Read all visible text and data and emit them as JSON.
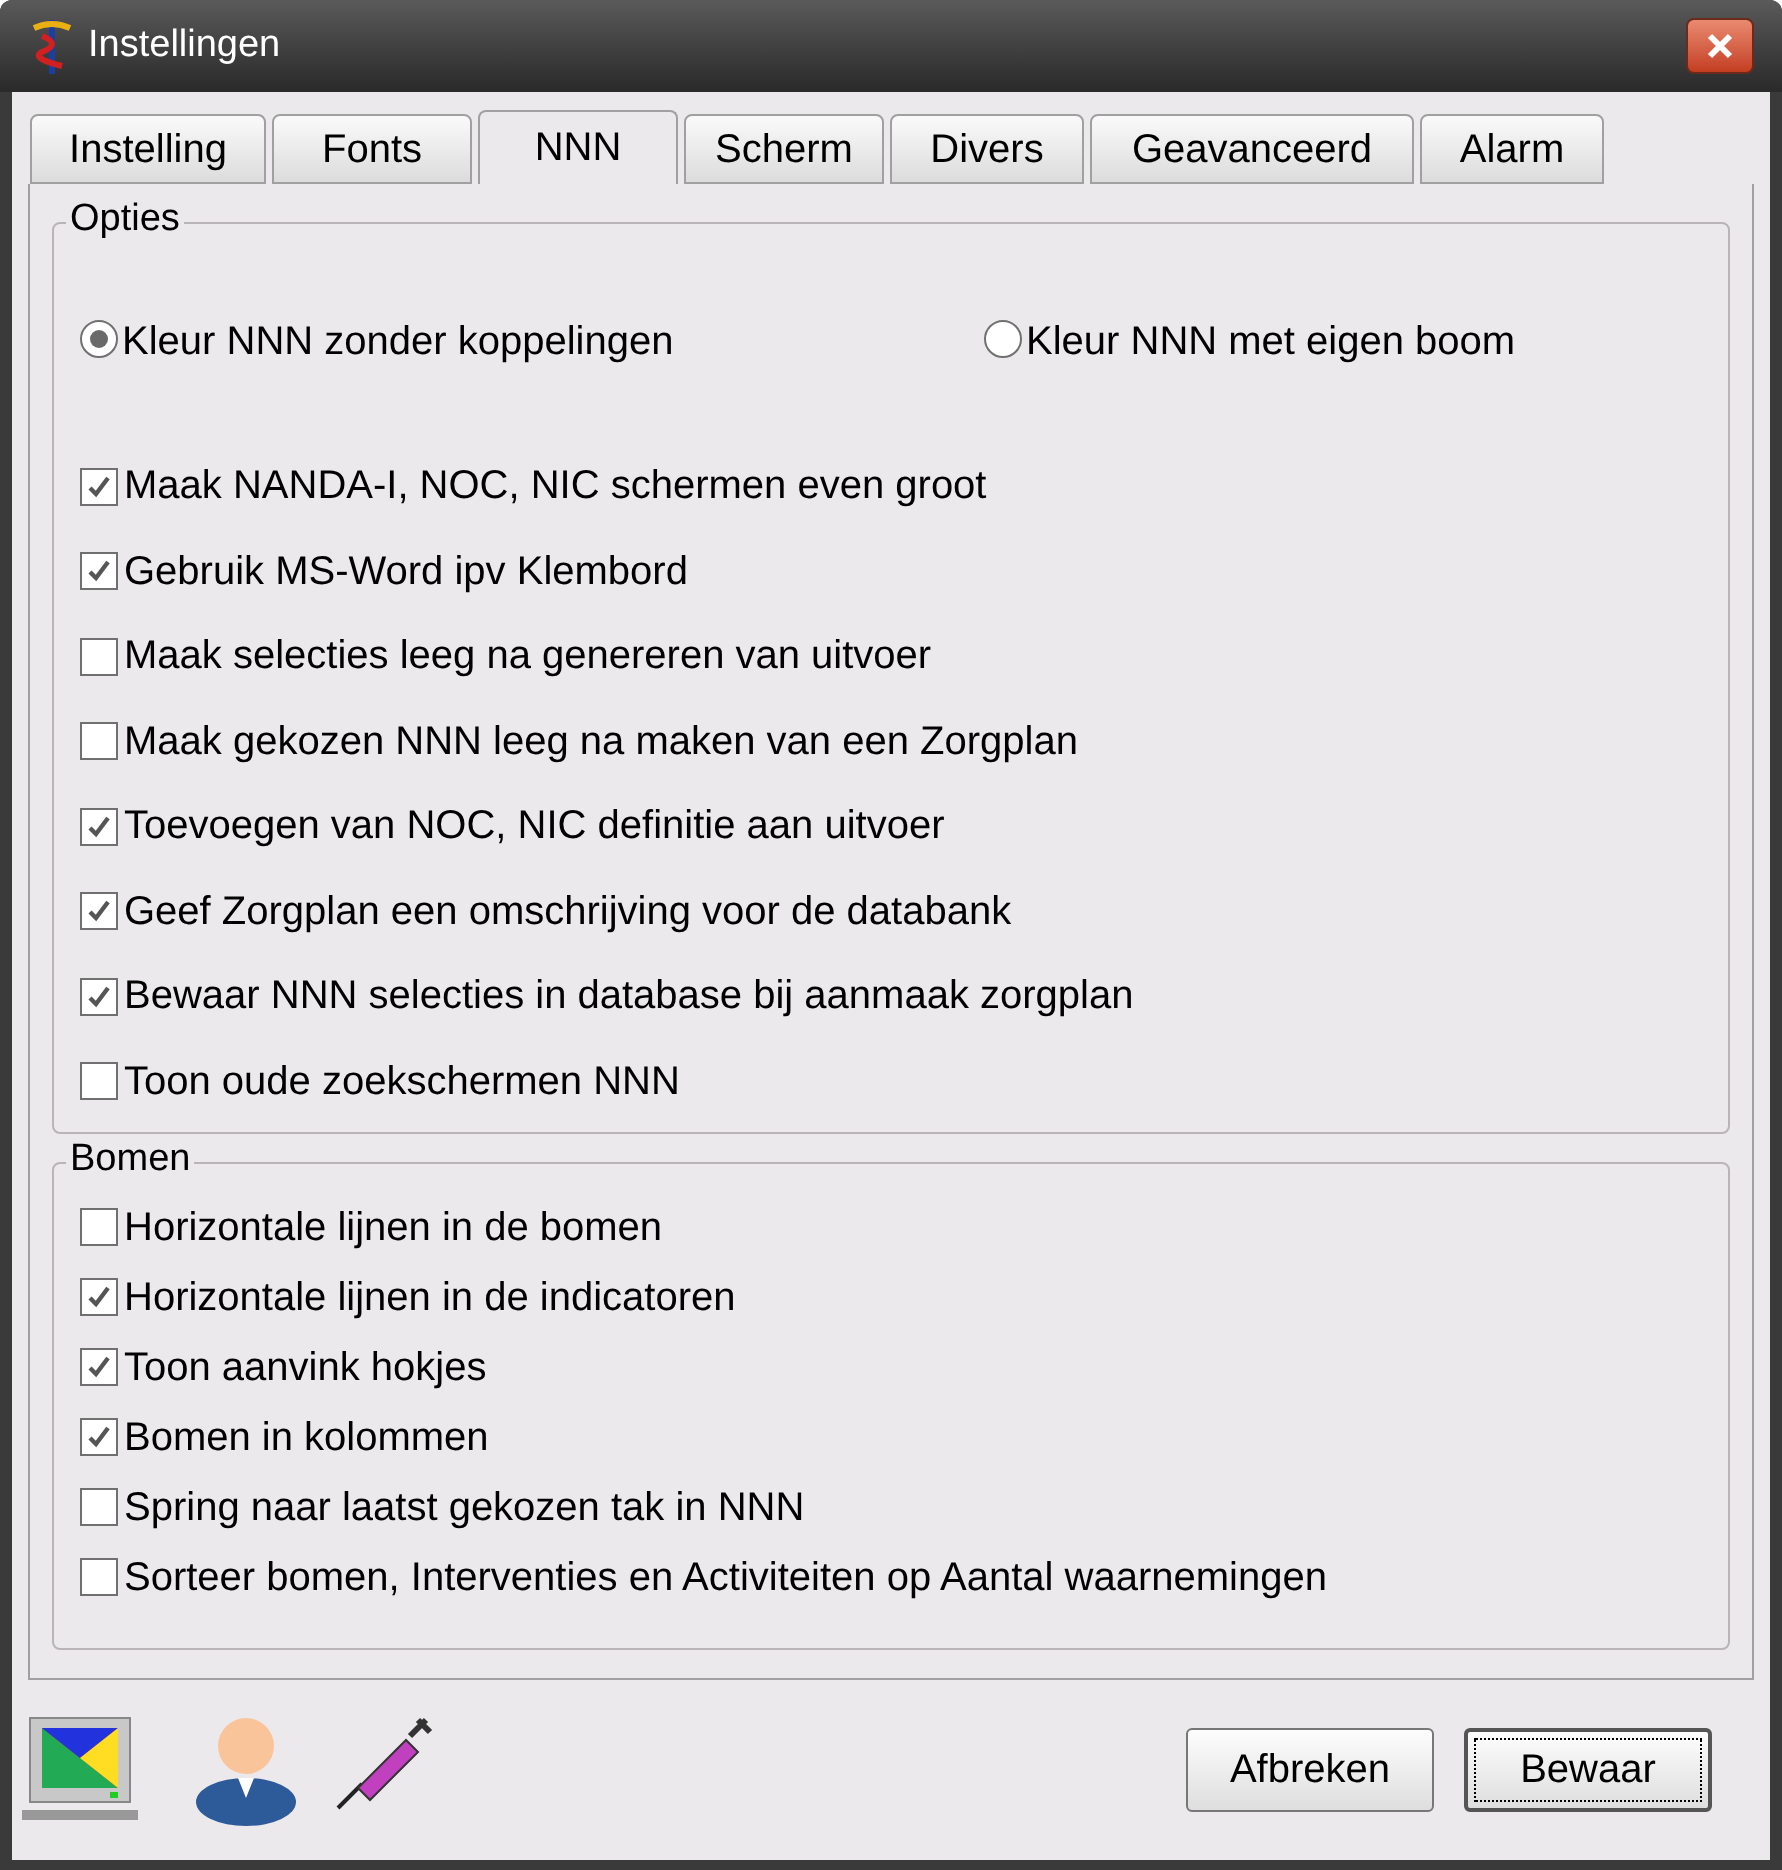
{
  "window": {
    "title": "Instellingen"
  },
  "tabs": [
    {
      "label": "Instelling",
      "selected": false
    },
    {
      "label": "Fonts",
      "selected": false
    },
    {
      "label": "NNN",
      "selected": true
    },
    {
      "label": "Scherm",
      "selected": false
    },
    {
      "label": "Divers",
      "selected": false
    },
    {
      "label": "Geavanceerd",
      "selected": false
    },
    {
      "label": "Alarm",
      "selected": false
    }
  ],
  "options": {
    "title": "Opties",
    "radios": [
      {
        "label": "Kleur NNN zonder koppelingen",
        "selected": true
      },
      {
        "label": "Kleur NNN met eigen boom",
        "selected": false
      }
    ],
    "checkboxes": [
      {
        "label": "Maak NANDA-I, NOC, NIC schermen even groot",
        "checked": true
      },
      {
        "label": "Gebruik MS-Word ipv Klembord",
        "checked": true
      },
      {
        "label": "Maak selecties leeg na genereren van uitvoer",
        "checked": false
      },
      {
        "label": "Maak gekozen NNN leeg na maken van een Zorgplan",
        "checked": false
      },
      {
        "label": "Toevoegen van NOC, NIC definitie aan uitvoer",
        "checked": true
      },
      {
        "label": "Geef Zorgplan een omschrijving voor de databank",
        "checked": true
      },
      {
        "label": "Bewaar NNN selecties in database bij aanmaak zorgplan",
        "checked": true
      },
      {
        "label": "Toon oude zoekschermen NNN",
        "checked": false
      }
    ]
  },
  "trees": {
    "title": "Bomen",
    "checkboxes": [
      {
        "label": "Horizontale lijnen in de bomen",
        "checked": false
      },
      {
        "label": "Horizontale lijnen in de indicatoren",
        "checked": true
      },
      {
        "label": "Toon aanvink hokjes",
        "checked": true
      },
      {
        "label": "Bomen in kolommen",
        "checked": true
      },
      {
        "label": "Spring naar laatst gekozen tak in NNN",
        "checked": false
      },
      {
        "label": "Sorteer bomen, Interventies en Activiteiten op Aantal waarnemingen",
        "checked": false
      }
    ]
  },
  "buttons": [
    {
      "label": "Afbreken",
      "focused": false
    },
    {
      "label": "Bewaar",
      "focused": true
    }
  ]
}
